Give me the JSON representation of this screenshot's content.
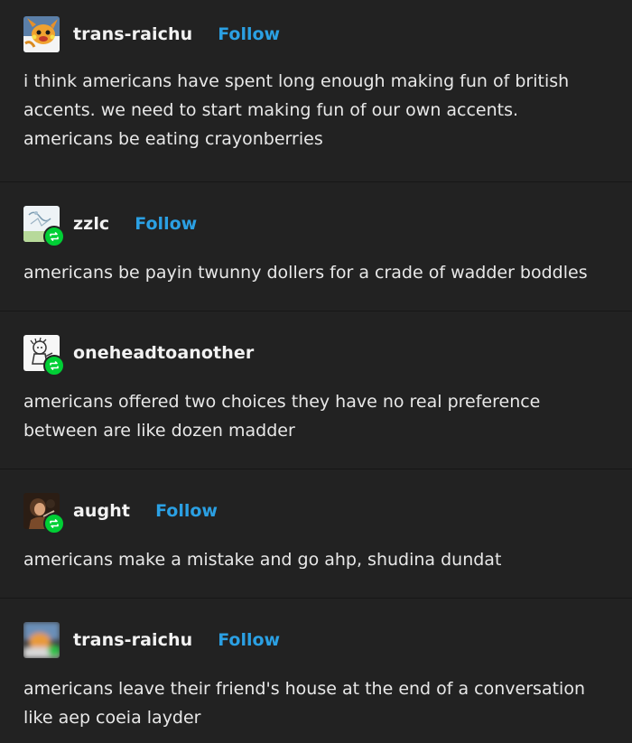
{
  "colors": {
    "background": "#222222",
    "text": "#e8e8e8",
    "follow": "#2ba0e3",
    "reblog_badge": "#00cf35"
  },
  "posts": [
    {
      "username": "trans-raichu",
      "follow_label": "Follow",
      "reblog": false,
      "avatar": "raichu-avatar",
      "text": "i think americans have spent long enough making fun of british accents. we need to start making fun of our own accents. americans be eating crayonberries"
    },
    {
      "username": "zzlc",
      "follow_label": "Follow",
      "reblog": true,
      "avatar": "sketch-avatar",
      "text": "americans be payin twunny dollers for a crade of wadder boddles"
    },
    {
      "username": "oneheadtoanother",
      "follow_label": "",
      "reblog": true,
      "avatar": "cartoon-avatar",
      "text": "americans offered two choices they have no real preference between are like dozen madder"
    },
    {
      "username": "aught",
      "follow_label": "Follow",
      "reblog": true,
      "avatar": "painting-avatar",
      "text": "americans make a mistake and go ahp, shudina dundat"
    },
    {
      "username": "trans-raichu",
      "follow_label": "Follow",
      "reblog": false,
      "avatar": "blurred-avatar",
      "text": "americans leave their friend's house at the end of a conversation like aep coeia layder"
    }
  ]
}
